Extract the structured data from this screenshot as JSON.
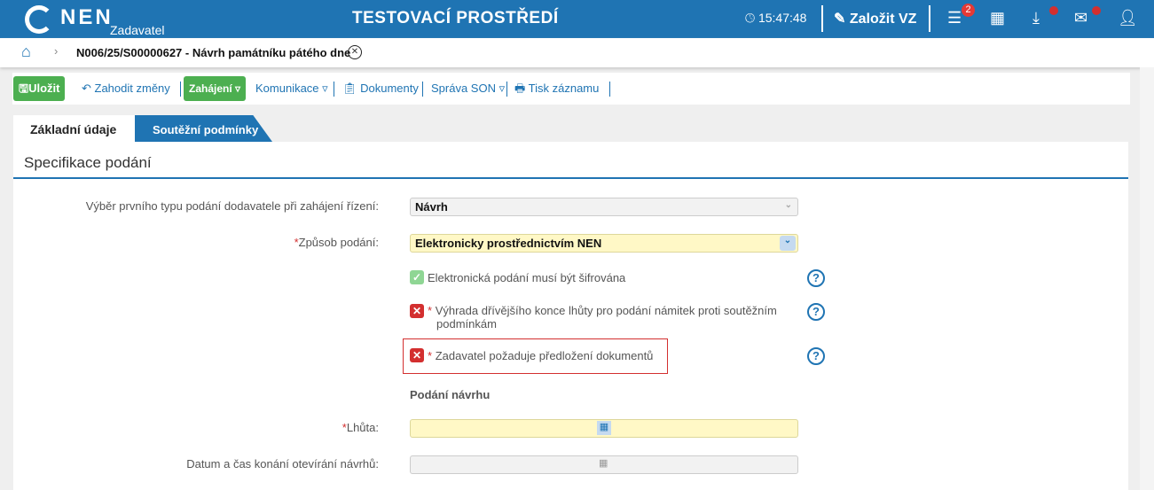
{
  "header": {
    "logo_text": "NEN",
    "role": "Zadavatel",
    "env_title": "TESTOVACÍ PROSTŘEDÍ",
    "time": "15:47:48",
    "create_label": "Založit VZ",
    "menu_badge": "2",
    "accent": "#1f74b3"
  },
  "breadcrumb": {
    "title": "N006/25/S00000627 - Návrh památníku pátého dne"
  },
  "toolbar": {
    "save": "Uložit",
    "discard": "Zahodit změny",
    "start": "Zahájení ▿",
    "communication": "Komunikace ▿",
    "documents": "Dokumenty",
    "son": "Správa SON ▿",
    "print": "Tisk záznamu"
  },
  "tabs": [
    {
      "label": "Základní údaje",
      "active": true
    },
    {
      "label": "Soutěžní podmínky",
      "active": false
    }
  ],
  "section": {
    "title": "Specifikace podání"
  },
  "form": {
    "first_type_label": "Výběr prvního typu podání dodavatele při zahájení řízení:",
    "first_type_value": "Návrh",
    "method_label": "Způsob podání:",
    "method_value": "Elektronicky prostřednictvím NEN",
    "encrypted_label": "Elektronická podání musí být šifrována",
    "encrypted_checked": true,
    "objection_label": "Výhrada dřívějšího konce lhůty pro podání námitek proti soutěžním podmínkám",
    "objection_checked": false,
    "documents_label": "Zadavatel požaduje předložení dokumentů",
    "documents_checked": false,
    "subheading": "Podání návrhu",
    "deadline_label": "Lhůta:",
    "deadline_value": "",
    "opening_label": "Datum a čas konání otevírání návrhů:",
    "opening_value": "",
    "required_mark": "*"
  }
}
